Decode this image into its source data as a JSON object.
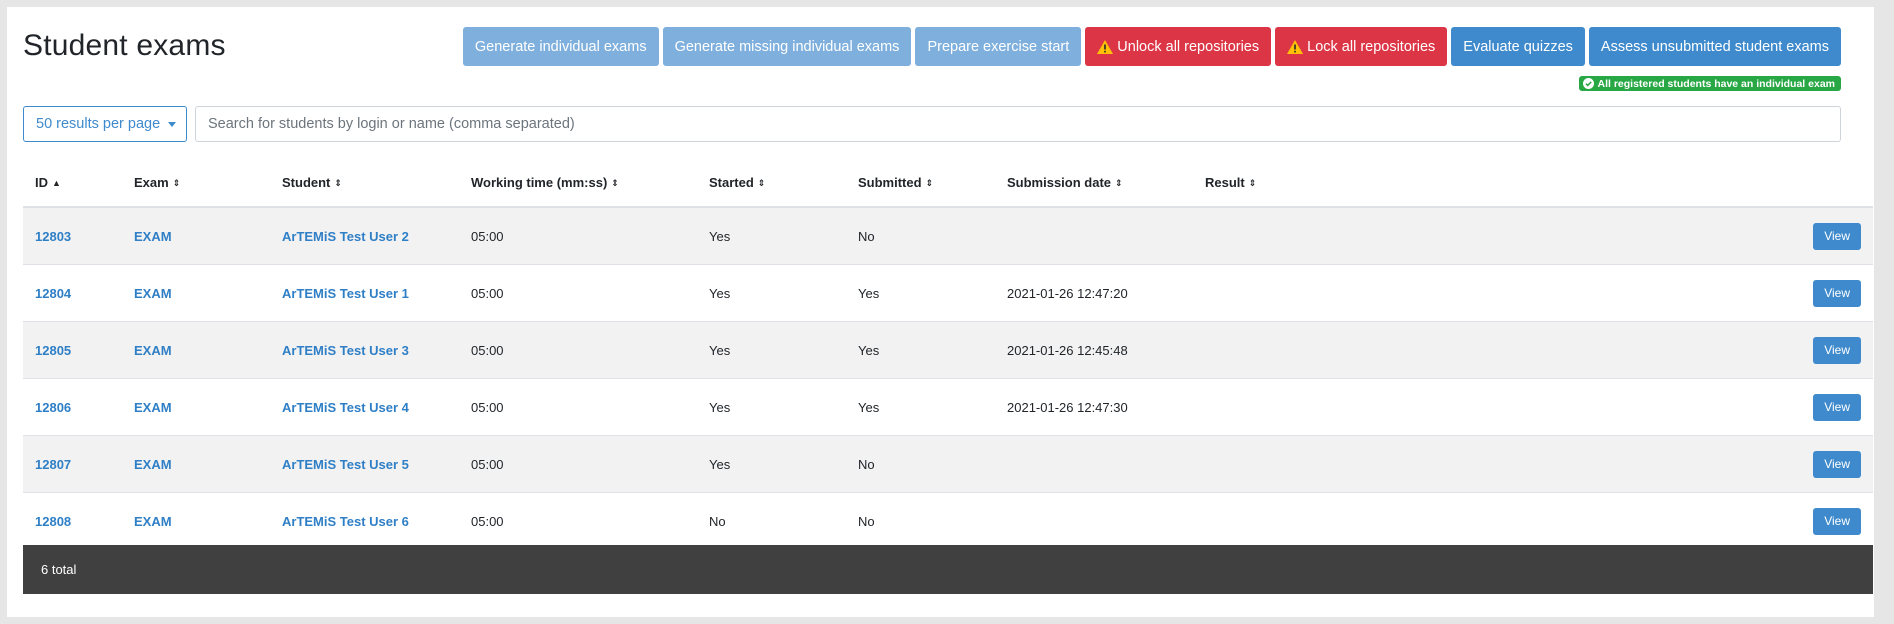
{
  "page": {
    "title": "Student exams"
  },
  "toolbar": {
    "generate_individual": "Generate individual exams",
    "generate_missing": "Generate missing individual exams",
    "prepare_start": "Prepare exercise start",
    "unlock_all": "Unlock all repositories",
    "lock_all": "Lock all repositories",
    "evaluate_quizzes": "Evaluate quizzes",
    "assess_unsubmitted": "Assess unsubmitted student exams"
  },
  "status_badge": "All registered students have an individual exam",
  "filters": {
    "per_page": "50 results per page",
    "search_placeholder": "Search for students by login or name (comma separated)"
  },
  "table": {
    "headers": {
      "id": "ID",
      "exam": "Exam",
      "student": "Student",
      "working_time": "Working time (mm:ss)",
      "started": "Started",
      "submitted": "Submitted",
      "submission_date": "Submission date",
      "result": "Result"
    },
    "view_label": "View",
    "rows": [
      {
        "id": "12803",
        "exam": "EXAM",
        "student": "ArTEMiS Test User 2",
        "working_time": "05:00",
        "started": "Yes",
        "submitted": "No",
        "submission_date": "",
        "result": ""
      },
      {
        "id": "12804",
        "exam": "EXAM",
        "student": "ArTEMiS Test User 1",
        "working_time": "05:00",
        "started": "Yes",
        "submitted": "Yes",
        "submission_date": "2021-01-26 12:47:20",
        "result": ""
      },
      {
        "id": "12805",
        "exam": "EXAM",
        "student": "ArTEMiS Test User 3",
        "working_time": "05:00",
        "started": "Yes",
        "submitted": "Yes",
        "submission_date": "2021-01-26 12:45:48",
        "result": ""
      },
      {
        "id": "12806",
        "exam": "EXAM",
        "student": "ArTEMiS Test User 4",
        "working_time": "05:00",
        "started": "Yes",
        "submitted": "Yes",
        "submission_date": "2021-01-26 12:47:30",
        "result": ""
      },
      {
        "id": "12807",
        "exam": "EXAM",
        "student": "ArTEMiS Test User 5",
        "working_time": "05:00",
        "started": "Yes",
        "submitted": "No",
        "submission_date": "",
        "result": ""
      },
      {
        "id": "12808",
        "exam": "EXAM",
        "student": "ArTEMiS Test User 6",
        "working_time": "05:00",
        "started": "No",
        "submitted": "No",
        "submission_date": "",
        "result": ""
      }
    ]
  },
  "footer": {
    "total": "6 total"
  },
  "colors": {
    "primary": "#3e8acc",
    "danger": "#dc3545",
    "success": "#28a745",
    "footer_bg": "#404040"
  }
}
